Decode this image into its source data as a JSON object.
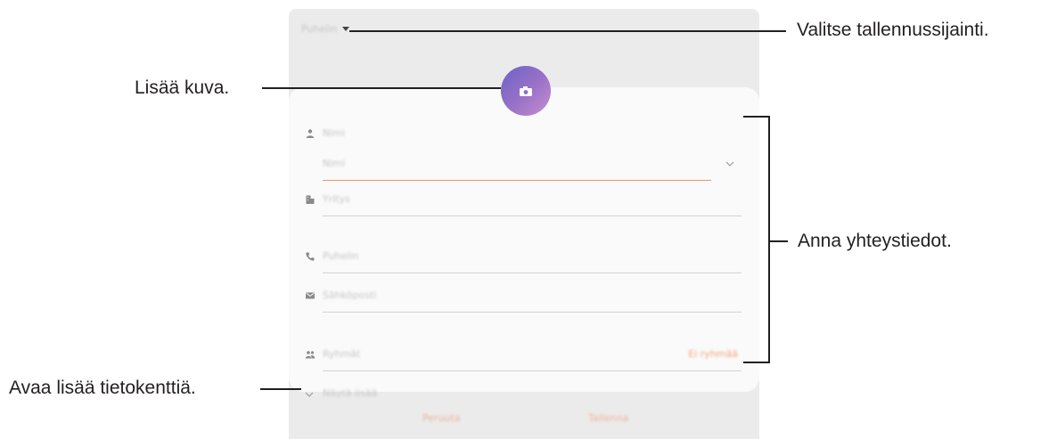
{
  "callouts": {
    "storage": "Valitse tallennussijainti.",
    "photo": "Lisää kuva.",
    "details": "Anna yhteystiedot.",
    "more_fields": "Avaa lisää tietokenttiä."
  },
  "screen": {
    "storage_label": "Puhelin",
    "fields": {
      "name_header": "Nimi",
      "name_value": "Nimi",
      "company": "Yritys",
      "phone": "Puhelin",
      "email": "Sähköposti",
      "groups": "Ryhmät",
      "groups_action": "Ei ryhmää",
      "more": "Näytä lisää"
    },
    "buttons": {
      "cancel": "Peruuta",
      "save": "Tallenna"
    }
  },
  "icons": [
    "camera-icon",
    "person-icon",
    "company-icon",
    "phone-icon",
    "email-icon",
    "groups-icon",
    "chevron-down-icon",
    "dropdown-caret-icon"
  ],
  "colors": {
    "accent": "#e8956b",
    "photo_gradient_start": "#6a63c4",
    "photo_gradient_end": "#c98fd0"
  }
}
